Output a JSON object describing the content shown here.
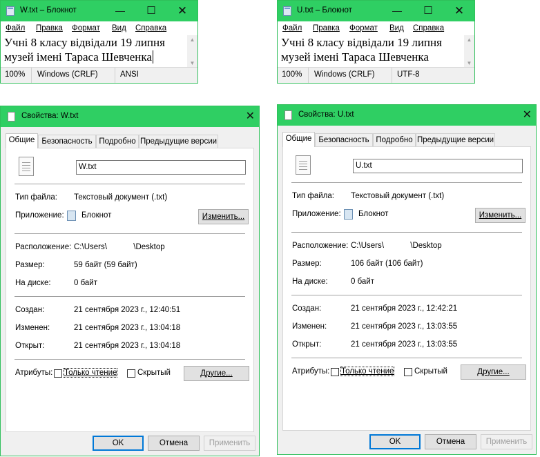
{
  "notepad_w": {
    "title": "W.txt – Блокнот",
    "menu": [
      "Файл",
      "Правка",
      "Формат",
      "Вид",
      "Справка"
    ],
    "text_lines": [
      "Учні 8 класу відвідали 19 липня",
      "музей імені Тараса Шевченка"
    ],
    "status_zoom": "100%",
    "status_eol": "Windows (CRLF)",
    "status_encoding": "ANSI"
  },
  "notepad_u": {
    "title": "U.txt – Блокнот",
    "menu": [
      "Файл",
      "Правка",
      "Формат",
      "Вид",
      "Справка"
    ],
    "text_lines": [
      "Учні 8 класу відвідали 19 липня",
      "музей імені Тараса Шевченка"
    ],
    "status_zoom": "100%",
    "status_eol": "Windows (CRLF)",
    "status_encoding": "UTF-8"
  },
  "props_w": {
    "title": "Свойства: W.txt",
    "tabs": [
      "Общие",
      "Безопасность",
      "Подробно",
      "Предыдущие версии"
    ],
    "file_name": "W.txt",
    "type_label": "Тип файла:",
    "type_value": "Текстовый документ (.txt)",
    "app_label": "Приложение:",
    "app_value": "Блокнот",
    "change_button": "Изменить...",
    "location_label": "Расположение:",
    "location_value": "C:\\Users\\            \\Desktop",
    "size_label": "Размер:",
    "size_value": "59 байт (59 байт)",
    "disk_label": "На диске:",
    "disk_value": "0 байт",
    "created_label": "Создан:",
    "created_value": "21 сентября 2023 г., 12:40:51",
    "modified_label": "Изменен:",
    "modified_value": "21 сентября 2023 г., 13:04:18",
    "opened_label": "Открыт:",
    "opened_value": "21 сентября 2023 г., 13:04:18",
    "attrs_label": "Атрибуты:",
    "readonly_label": "Только чтение",
    "hidden_label": "Скрытый",
    "other_button": "Другие...",
    "ok_button": "OK",
    "cancel_button": "Отмена",
    "apply_button": "Применить"
  },
  "props_u": {
    "title": "Свойства: U.txt",
    "tabs": [
      "Общие",
      "Безопасность",
      "Подробно",
      "Предыдущие версии"
    ],
    "file_name": "U.txt",
    "type_label": "Тип файла:",
    "type_value": "Текстовый документ (.txt)",
    "app_label": "Приложение:",
    "app_value": "Блокнот",
    "change_button": "Изменить...",
    "location_label": "Расположение:",
    "location_value": "C:\\Users\\            \\Desktop",
    "size_label": "Размер:",
    "size_value": "106 байт (106 байт)",
    "disk_label": "На диске:",
    "disk_value": "0 байт",
    "created_label": "Создан:",
    "created_value": "21 сентября 2023 г., 12:42:21",
    "modified_label": "Изменен:",
    "modified_value": "21 сентября 2023 г., 13:03:55",
    "opened_label": "Открыт:",
    "opened_value": "21 сентября 2023 г., 13:03:55",
    "attrs_label": "Атрибуты:",
    "readonly_label": "Только чтение",
    "hidden_label": "Скрытый",
    "other_button": "Другие...",
    "ok_button": "OK",
    "cancel_button": "Отмена",
    "apply_button": "Применить"
  },
  "colors": {
    "titlebar": "#2fcf63",
    "dialog_bg": "#f0f0f0",
    "default_button_border": "#0078d7"
  }
}
